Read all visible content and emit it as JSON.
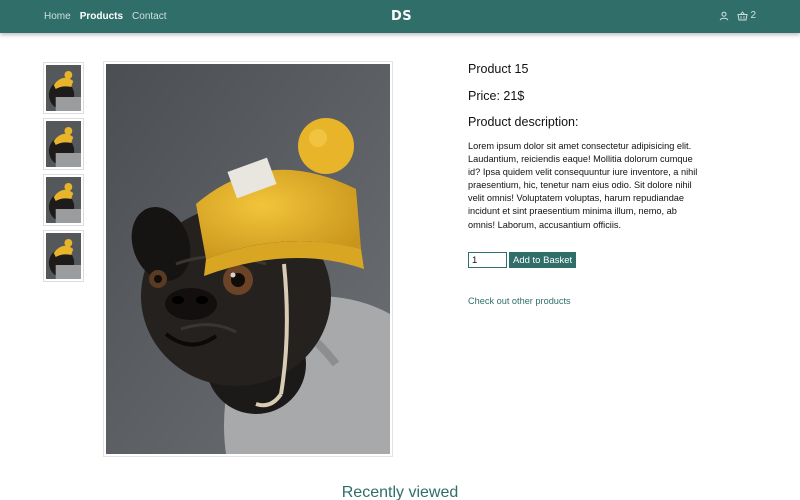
{
  "nav": {
    "links": [
      {
        "label": "Home",
        "active": false
      },
      {
        "label": "Products",
        "active": true
      },
      {
        "label": "Contact",
        "active": false
      }
    ],
    "logo": "DS",
    "basket_count": "2",
    "icons": [
      "user-icon",
      "basket-icon"
    ]
  },
  "gallery": {
    "thumbnail_count": 4,
    "main_image": "pug-yellow-beanie-photo"
  },
  "product": {
    "name": "Product 15",
    "price_line": "Price: 21$",
    "description_heading": "Product description:",
    "description": "Lorem ipsum dolor sit amet consectetur adipisicing elit. Laudantium, reiciendis eaque! Mollitia dolorum cumque id? Ipsa quidem velit consequuntur iure inventore, a nihil praesentium, hic, tenetur nam eius odio. Sit dolore nihil velit omnis! Voluptatem voluptas, harum repudiandae incidunt et sint praesentium minima illum, nemo, ab omnis! Laborum, accusantium officiis.",
    "quantity": "1",
    "add_button": "Add to Basket",
    "other_link": "Check out other products"
  },
  "recent": {
    "heading": "Recently viewed"
  },
  "colors": {
    "brand": "#2f6e69",
    "accent_yellow": "#e8b52a"
  }
}
